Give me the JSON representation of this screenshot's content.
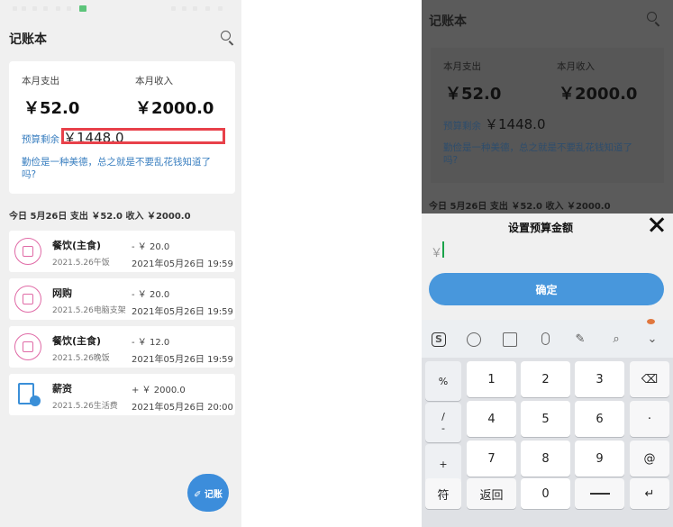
{
  "app": {
    "title": "记账本"
  },
  "summary": {
    "expense_label": "本月支出",
    "expense_value": "￥52.0",
    "income_label": "本月收入",
    "income_value": "￥2000.0",
    "budget_label": "预算剩余",
    "budget_value": "￥1448.0",
    "motto": "勤俭是一种美德，总之就是不要乱花钱知道了吗?"
  },
  "today_line": "今日 5月26日 支出 ￥52.0 收入 ￥2000.0",
  "transactions": [
    {
      "category": "餐饮(主食)",
      "note": "2021.5.26午饭",
      "amount": "- ￥ 20.0",
      "time": "2021年05月26日 19:59",
      "icon": "dining-icon"
    },
    {
      "category": "网购",
      "note": "2021.5.26电脑支架",
      "amount": "- ￥ 20.0",
      "time": "2021年05月26日 19:59",
      "icon": "delivery-truck-icon"
    },
    {
      "category": "餐饮(主食)",
      "note": "2021.5.26晚饭",
      "amount": "- ￥ 12.0",
      "time": "2021年05月26日 19:59",
      "icon": "dining-icon"
    },
    {
      "category": "薪资",
      "note": "2021.5.26生活费",
      "amount": "+ ￥ 2000.0",
      "time": "2021年05月26日 20:00",
      "icon": "salary-icon"
    }
  ],
  "fab_label": "✐ 记账",
  "dialog": {
    "title": "设置预算金额",
    "input_prefix": "￥",
    "input_value": "",
    "confirm_label": "确定"
  },
  "keyboard": {
    "toolbar_icons": [
      "sogou-s-icon",
      "emoji-icon",
      "keyboard-icon",
      "mic-icon",
      "handwriting-icon",
      "search-icon",
      "collapse-icon"
    ],
    "symbols": [
      "%",
      "/",
      "-",
      "+"
    ],
    "keys_row1": [
      "1",
      "2",
      "3"
    ],
    "keys_row2": [
      "4",
      "5",
      "6"
    ],
    "keys_row3": [
      "7",
      "8",
      "9"
    ],
    "right_keys": [
      "⌫",
      "·",
      "@",
      "↵"
    ],
    "bottom": {
      "symbol": "符",
      "back": "返回",
      "zero": "0"
    }
  },
  "colors": {
    "accent": "#3c8ddb",
    "highlight_box": "#e8414a",
    "link_text": "#3a7fc0",
    "category_pink": "#e06aa6"
  }
}
